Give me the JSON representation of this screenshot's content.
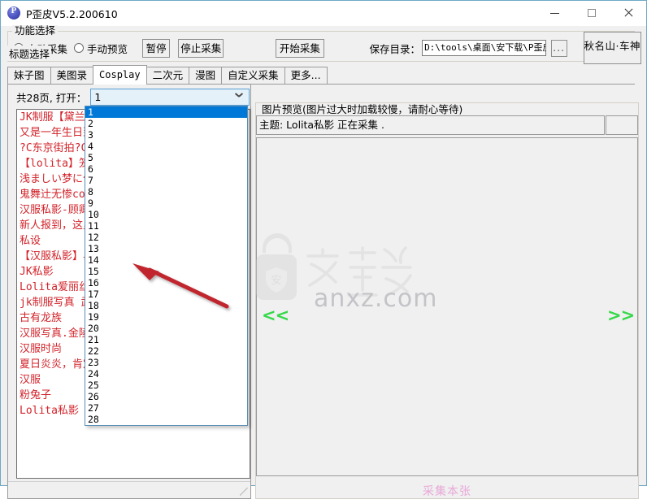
{
  "window": {
    "title": "P歪皮V5.2.200610",
    "app_icon": "app-logo-icon",
    "minimize": "—",
    "maximize": "□",
    "close": "✕"
  },
  "function_group": {
    "legend": "功能选择",
    "radio_auto": "自动采集",
    "radio_manual": "手动预览",
    "btn_pause": "暂停",
    "btn_stop": "停止采集",
    "btn_start": "开始采集",
    "save_label": "保存目录：",
    "save_path": "D:\\tools\\桌面\\安下载\\P歪皮-多图采",
    "btn_browse": "...",
    "btn_brand": "秋名山·车神"
  },
  "tabs": [
    {
      "label": "妹子图",
      "selected": false
    },
    {
      "label": "美图录",
      "selected": false
    },
    {
      "label": "Cosplay",
      "selected": true
    },
    {
      "label": "二次元",
      "selected": false
    },
    {
      "label": "漫图",
      "selected": false
    },
    {
      "label": "自定义采集",
      "selected": false
    },
    {
      "label": "更多...",
      "selected": false
    }
  ],
  "left_panel": {
    "page_label": "共28页, 打开：",
    "page_value": "1",
    "list_legend": "标题选择",
    "dropdown_options": [
      "1",
      "2",
      "3",
      "4",
      "5",
      "6",
      "7",
      "8",
      "9",
      "10",
      "11",
      "12",
      "13",
      "14",
      "15",
      "16",
      "17",
      "18",
      "19",
      "20",
      "21",
      "22",
      "23",
      "24",
      "25",
      "26",
      "27",
      "28"
    ],
    "dropdown_selected": "1",
    "titles": [
      "JK制服【黛兰】",
      "又是一年生日到 э",
      "?C东京街拍?C?C中",
      "【lolita】笼中梦",
      "浅ましい梦に化か",
      "鬼舞辻无惨cos",
      "汉服私影-顾卿颜",
      "新人报到，这里c",
      "私设",
      "【汉服私影】昙花",
      "JK私影",
      "Lolita爱丽丝的梦",
      "jk制服写真 武装",
      "古有龙族",
      "汉服写真.金陵往",
      "汉服时尚",
      "夏日炎炎，肯定还",
      "汉服",
      "粉兔子",
      "Lolita私影"
    ]
  },
  "right_panel": {
    "legend": "图片预览(图片过大时加载较慢，请耐心等待)",
    "subject": "主题: Lolita私影 正在采集 .",
    "nav_prev": "<<",
    "nav_next": ">>",
    "collect_current": "采集本张",
    "watermark_text": "anxz.com",
    "watermark_logo": "安下载"
  },
  "colors": {
    "accent_blue": "#0078d7",
    "window_border": "#6ea8c4",
    "title_list_red": "#d2232a",
    "nav_green": "#36d94a",
    "collect_pink": "#e8a8d8",
    "annotation_red": "#c1282d",
    "face_gray": "#f0f0f0"
  }
}
